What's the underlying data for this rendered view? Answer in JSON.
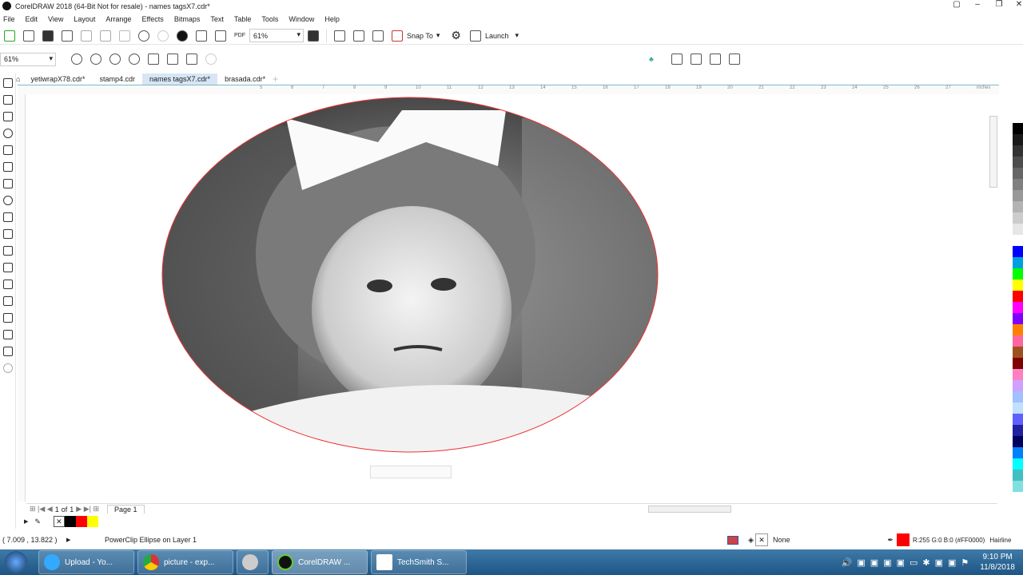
{
  "window": {
    "title": "CorelDRAW 2018 (64-Bit Not for resale) - names tagsX7.cdr*"
  },
  "menu": [
    "File",
    "Edit",
    "View",
    "Layout",
    "Arrange",
    "Effects",
    "Bitmaps",
    "Text",
    "Table",
    "Tools",
    "Window",
    "Help"
  ],
  "toolbar": {
    "zoom_value": "61%",
    "snap_label": "Snap To",
    "launch_label": "Launch",
    "pdf_label": "PDF"
  },
  "toolbar2": {
    "zoom_value": "61%"
  },
  "tabs": [
    {
      "label": "yetiwrapX78.cdr*"
    },
    {
      "label": "stamp4.cdr"
    },
    {
      "label": "names tagsX7.cdr*",
      "active": true
    },
    {
      "label": "brasada.cdr*"
    }
  ],
  "ruler": {
    "unit": "inches",
    "labels": [
      "5",
      "6",
      "7",
      "8",
      "9",
      "10",
      "11",
      "12",
      "13",
      "14",
      "15",
      "16",
      "17",
      "18",
      "19",
      "20",
      "21",
      "22",
      "23",
      "24",
      "25",
      "26",
      "27"
    ]
  },
  "page_nav": {
    "current": "1",
    "of_label": "of",
    "total": "1",
    "page_tab": "Page 1"
  },
  "document_palette": [
    "#000000",
    "#FF0000",
    "#FFFF00"
  ],
  "color_palette": [
    "#ffffff",
    "#000000",
    "#1a1a1a",
    "#333333",
    "#4d4d4d",
    "#666666",
    "#808080",
    "#999999",
    "#b3b3b3",
    "#cccccc",
    "#e6e6e6",
    "#ffffff",
    "#0000ff",
    "#00a0e0",
    "#00ff00",
    "#ffff00",
    "#ff0000",
    "#ff00ff",
    "#8000ff",
    "#ff8000",
    "#ff66a0",
    "#a05020",
    "#800000",
    "#ff80c0",
    "#d0a0ff",
    "#a0c0ff",
    "#c0e0ff",
    "#6060ff",
    "#2020a0",
    "#000060",
    "#0080ff",
    "#00ffff",
    "#40c0c0",
    "#80e0e0"
  ],
  "status": {
    "coords": "( 7.009 , 13.822 )",
    "object_info": "PowerClip Ellipse on Layer 1",
    "fill_label": "None",
    "outline_color": "R:255 G:0 B:0 (#FF0000)",
    "outline_width": "Hairline",
    "outline_swatch": "#FF0000"
  },
  "taskbar": {
    "items": [
      {
        "label": "Upload - Yo..."
      },
      {
        "label": "picture - exp..."
      },
      {
        "label": ""
      },
      {
        "label": "CorelDRAW ..."
      },
      {
        "label": "TechSmith S..."
      }
    ],
    "time": "9:10 PM",
    "date": "11/8/2018"
  }
}
